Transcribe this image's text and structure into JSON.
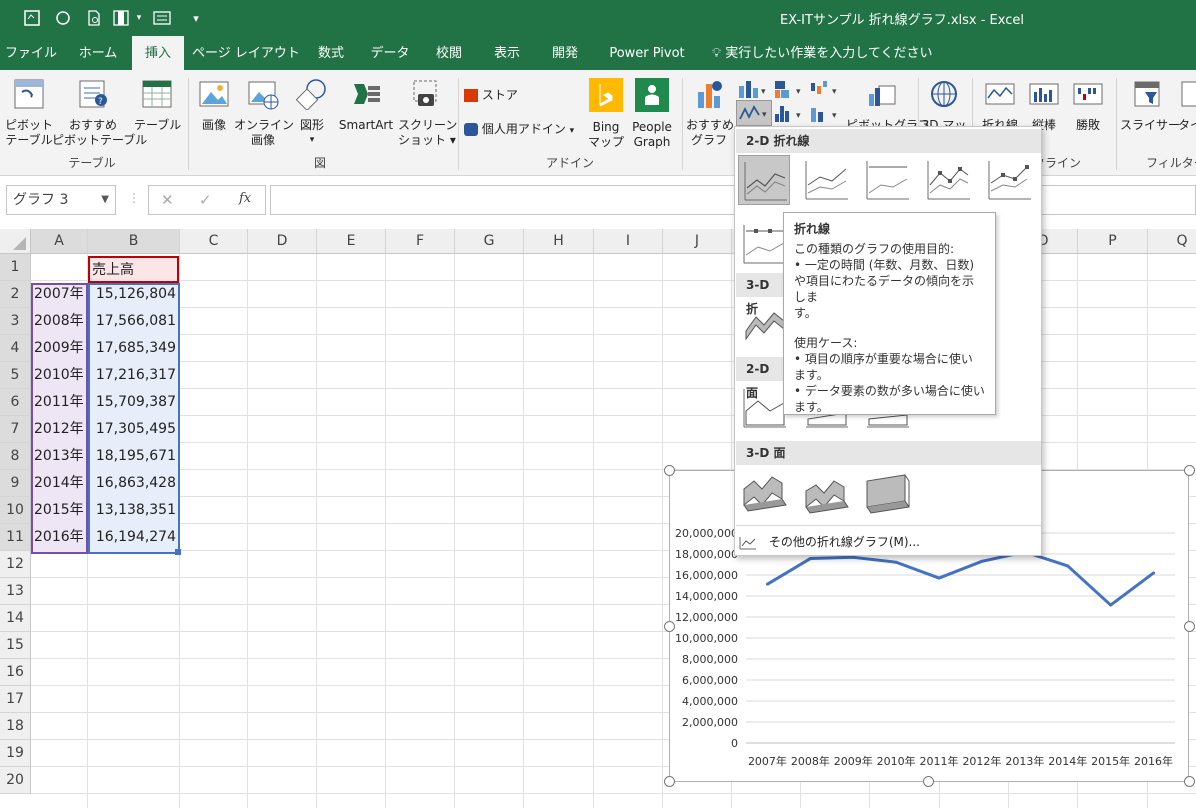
{
  "title": "EX-ITサンプル  折れ線グラフ.xlsx  -  Excel",
  "colors": {
    "accent": "#217346",
    "series": "#4472c4",
    "tab_active_text": "#217346"
  },
  "tabs": [
    "ファイル",
    "ホーム",
    "挿入",
    "ページ レイアウト",
    "数式",
    "データ",
    "校閲",
    "表示",
    "開発",
    "Power Pivot"
  ],
  "tell_me": "実行したい作業を入力してください",
  "ribbon": {
    "buttons": {
      "pivot_l1": "ピボット",
      "pivot_l2": "テーブル",
      "recpivot_l1": "おすすめ",
      "recpivot_l2": "ピボットテーブル",
      "table": "テーブル",
      "image": "画像",
      "online_l1": "オンライン",
      "online_l2": "画像",
      "shape": "図形",
      "smartart": "SmartArt",
      "screenshot_l1": "スクリーン",
      "screenshot_l2": "ショット",
      "store": "ストア",
      "addin": "個人用アドイン",
      "bing_l1": "Bing",
      "bing_l2": "マップ",
      "people_l1": "People",
      "people_l2": "Graph",
      "recchart_l1": "おすすめ",
      "recchart_l2": "グラフ",
      "pivotchart": "ピボットグラフ",
      "map3d": "3D マッ",
      "spark_line": "折れ線",
      "spark_col": "縦棒",
      "spark_wl": "勝敗",
      "slicer": "スライサー",
      "timeline": "タイ"
    },
    "groups": {
      "table": "テーブル",
      "figure": "図",
      "addin": "アドイン",
      "sparkline": "クライン",
      "filter": "フィルター"
    }
  },
  "formula_bar": {
    "name_box": "グラフ 3",
    "fx": "fx",
    "value": ""
  },
  "sheet": {
    "columns": [
      "A",
      "B",
      "C",
      "D",
      "E",
      "F",
      "G",
      "H",
      "I",
      "J",
      "K",
      "L",
      "M",
      "N",
      "O",
      "P",
      "Q"
    ],
    "rows": [
      "1",
      "2",
      "3",
      "4",
      "5",
      "6",
      "7",
      "8",
      "9",
      "10",
      "11",
      "12",
      "13",
      "14",
      "15",
      "16",
      "17",
      "18",
      "19",
      "20"
    ],
    "header_b1": "売上高",
    "data": [
      {
        "year": "2007年",
        "sales": "15,126,804"
      },
      {
        "year": "2008年",
        "sales": "17,566,081"
      },
      {
        "year": "2009年",
        "sales": "17,685,349"
      },
      {
        "year": "2010年",
        "sales": "17,216,317"
      },
      {
        "year": "2011年",
        "sales": "15,709,387"
      },
      {
        "year": "2012年",
        "sales": "17,305,495"
      },
      {
        "year": "2013年",
        "sales": "18,195,671"
      },
      {
        "year": "2014年",
        "sales": "16,863,428"
      },
      {
        "year": "2015年",
        "sales": "13,138,351"
      },
      {
        "year": "2016年",
        "sales": "16,194,274"
      }
    ]
  },
  "dropdown": {
    "section_2d_line": "2-D 折れ線",
    "section_3d_line": "3-D 折",
    "section_2d_area": "2-D 面",
    "section_3d_area": "3-D 面",
    "more": "その他の折れ線グラフ(M)..."
  },
  "tooltip": {
    "title": "折れ線",
    "line1": "この種類のグラフの使用目的:",
    "line2": "• 一定の時間 (年数、月数、日数)",
    "line3": "や項目にわたるデータの傾向を示しま",
    "line4": "す。",
    "line5": "使用ケース:",
    "line6": "• 項目の順序が重要な場合に使い",
    "line7": "ます。",
    "line8": "• データ要素の数が多い場合に使い",
    "line9": "ます。"
  },
  "chart_data": {
    "type": "line",
    "categories": [
      "2007年",
      "2008年",
      "2009年",
      "2010年",
      "2011年",
      "2012年",
      "2013年",
      "2014年",
      "2015年",
      "2016年"
    ],
    "series": [
      {
        "values": [
          15126804,
          17566081,
          17685349,
          17216317,
          15709387,
          17305495,
          18195671,
          16863428,
          13138351,
          16194274
        ]
      }
    ],
    "ylim": [
      0,
      20000000
    ],
    "yticks": [
      "0",
      "2,000,000",
      "4,000,000",
      "6,000,000",
      "8,000,000",
      "10,000,000",
      "12,000,000",
      "14,000,000",
      "16,000,000",
      "18,000,000",
      "20,000,000"
    ],
    "grid": true
  }
}
